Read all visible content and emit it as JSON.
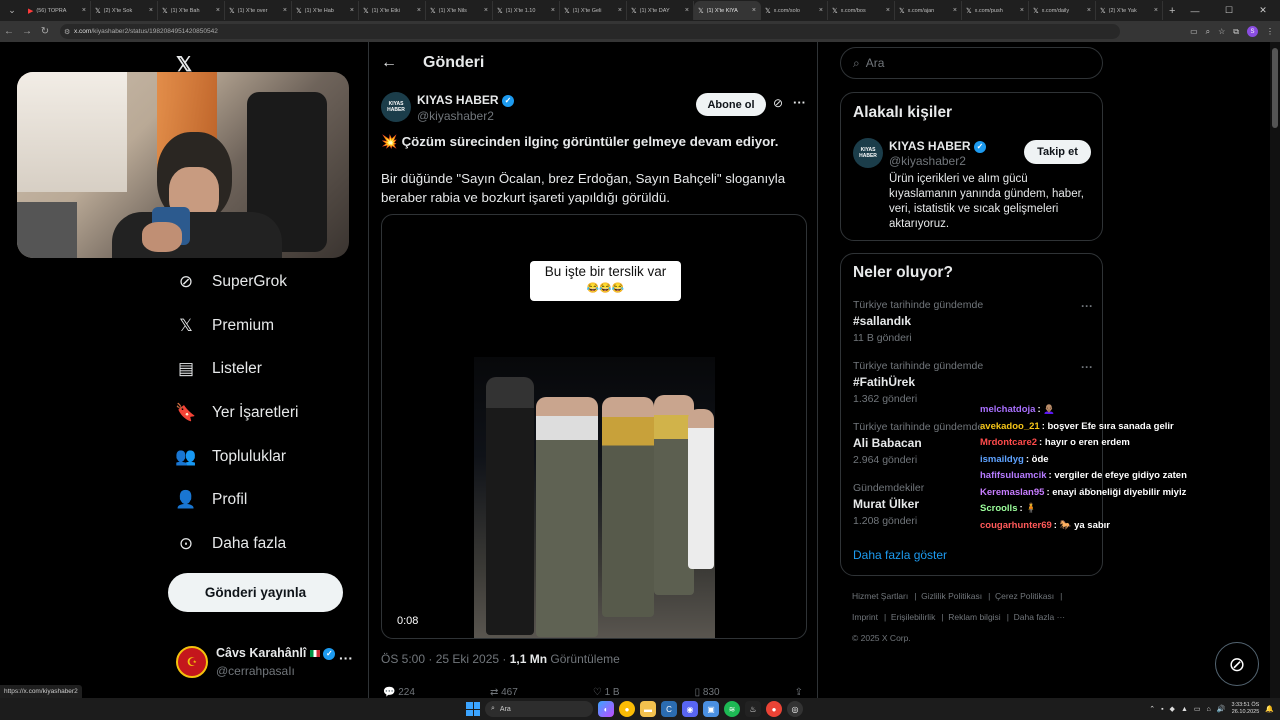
{
  "browser": {
    "tabs": [
      {
        "title": "(56) TOPRA",
        "icon": "youtube-icon",
        "active": false
      },
      {
        "title": "(2) X'te Sok",
        "icon": "x-icon",
        "active": false
      },
      {
        "title": "(1) X'te Bah",
        "icon": "x-icon",
        "active": false
      },
      {
        "title": "(1) X'te over",
        "icon": "x-icon",
        "active": false
      },
      {
        "title": "(1) X'te Hab",
        "icon": "x-icon",
        "active": false
      },
      {
        "title": "(1) X'te Etki",
        "icon": "x-icon",
        "active": false
      },
      {
        "title": "(1) X'te Nils",
        "icon": "x-icon",
        "active": false
      },
      {
        "title": "(1) X'te 1.10",
        "icon": "x-icon",
        "active": false
      },
      {
        "title": "(1) X'te Geli",
        "icon": "x-icon",
        "active": false
      },
      {
        "title": "(1) X'te DAY",
        "icon": "x-icon",
        "active": false
      },
      {
        "title": "(1) X'te KIYA",
        "icon": "x-icon",
        "active": true
      },
      {
        "title": "x.com/solo",
        "icon": "x-icon",
        "active": false
      },
      {
        "title": "x.com/bos",
        "icon": "x-icon",
        "active": false
      },
      {
        "title": "x.com/ajan",
        "icon": "x-icon",
        "active": false
      },
      {
        "title": "x.com/push",
        "icon": "x-icon",
        "active": false
      },
      {
        "title": "x.com/daily",
        "icon": "x-icon",
        "active": false
      },
      {
        "title": "(2) X'te Yak",
        "icon": "x-icon",
        "active": false
      }
    ],
    "url_domain": "x.com",
    "url_path": "/kiyashaber2/status/1982084951420850542",
    "status_url": "https://x.com/kiyashaber2",
    "profile_initial": "S"
  },
  "sidebar": {
    "items": [
      {
        "label": "SuperGrok",
        "icon": "grok-icon"
      },
      {
        "label": "Premium",
        "icon": "x-premium-icon"
      },
      {
        "label": "Listeler",
        "icon": "list-icon"
      },
      {
        "label": "Yer İşaretleri",
        "icon": "bookmark-icon"
      },
      {
        "label": "Topluluklar",
        "icon": "communities-icon"
      },
      {
        "label": "Profil",
        "icon": "profile-icon"
      },
      {
        "label": "Daha fazla",
        "icon": "more-circle-icon"
      }
    ],
    "post_button": "Gönderi yayınla",
    "account": {
      "name": "Câvs Karahânlî",
      "handle": "@cerrahpasaIı"
    }
  },
  "header": {
    "title": "Gönderi"
  },
  "tweet": {
    "author_name": "KIYAS HABER",
    "author_handle": "@kiyashaber2",
    "avatar_text": "KIYAS HABER",
    "subscribe_label": "Abone ol",
    "headline": "Çözüm sürecinden ilginç görüntüler gelmeye devam ediyor.",
    "body": "Bir düğünde \"Sayın Öcalan, brez Erdoğan, Sayın Bahçeli\" sloganıyla beraber rabia ve bozkurt işareti yapıldığı görüldü.",
    "video_caption": "Bu işte bir terslik var",
    "video_caption_emoji": "😂😂😂",
    "video_duration": "0:08",
    "timestamp": "ÖS 5:00 · 25 Eki 2025 · ",
    "views": "1,1 Mn",
    "views_label": " Görüntüleme",
    "actions": [
      "224",
      "467",
      "1 B",
      "830"
    ]
  },
  "right": {
    "search_placeholder": "Ara",
    "related_title": "Alakalı kişiler",
    "related": {
      "name": "KIYAS HABER",
      "handle": "@kiyashaber2",
      "follow_label": "Takip et",
      "bio": "Ürün içerikleri ve alım gücü kıyaslamanın yanında gündem, haber, veri, istatistik ve sıcak gelişmeleri aktarıyoruz."
    },
    "trends_title": "Neler oluyor?",
    "trends": [
      {
        "context": "Türkiye tarihinde gündemde",
        "name": "#sallandık",
        "posts": "11 B gönderi"
      },
      {
        "context": "Türkiye tarihinde gündemde",
        "name": "#FatihÜrek",
        "posts": "1.362 gönderi"
      },
      {
        "context": "Türkiye tarihinde gündemde",
        "name": "Ali Babacan",
        "posts": "2.964 gönderi"
      },
      {
        "context": "Gündemdekiler",
        "name": "Murat Ülker",
        "posts": "1.208 gönderi"
      }
    ],
    "show_more": "Daha fazla göster",
    "footer": [
      "Hizmet Şartları",
      "Gizlilik Politikası",
      "Çerez Politikası",
      "Imprint",
      "Erişilebilirlik",
      "Reklam bilgisi",
      "Daha fazla ···",
      "© 2025 X Corp."
    ]
  },
  "chat": [
    {
      "user": "melchatdoja",
      "color": "#a970ff",
      "message": "👩🏽‍🦲"
    },
    {
      "user": "avekadoo_21",
      "color": "#f5c518",
      "message": "boşver Efe sıra sanada gelir"
    },
    {
      "user": "Mrdontcare2",
      "color": "#ff4b4b",
      "message": "hayır o eren erdem"
    },
    {
      "user": "ismaildyg",
      "color": "#5ea2ff",
      "message": "öde"
    },
    {
      "user": "hafifsuluamcik",
      "color": "#b67bff",
      "message": "vergiler de efeye gidiyo zaten"
    },
    {
      "user": "Keremaslan95",
      "color": "#c77dff",
      "message": "enayi aboneliği diyebilir miyiz"
    },
    {
      "user": "Scroolls",
      "color": "#9cff9c",
      "message": "🧍"
    },
    {
      "user": "cougarhunter69",
      "color": "#ff5a5a",
      "message": "🐎 ya sabır"
    }
  ],
  "taskbar": {
    "search_label": "Ara",
    "time": "3:33:51 ÖS",
    "date": "26.10.2025"
  }
}
